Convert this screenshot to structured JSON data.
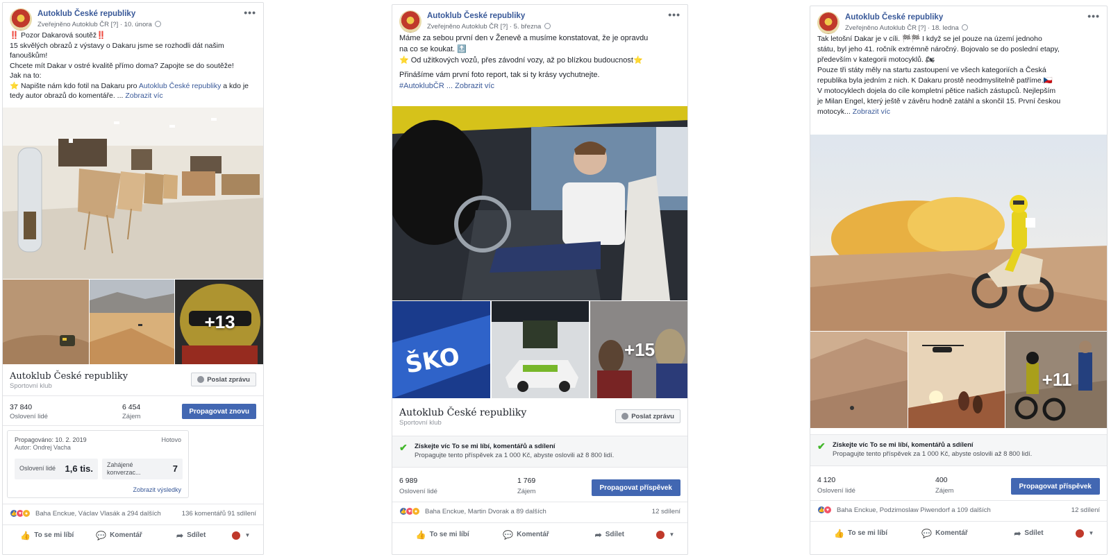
{
  "posts": [
    {
      "page_name": "Autoklub České republiky",
      "published_by": "Zveřejněno",
      "publisher": "Autoklub ČR",
      "q": "[?]",
      "date": "10. února",
      "menu": "•••",
      "text_lines": [
        "‼️ Pozor Dakarová soutěž‼️",
        "15 skvělých obrazů z výstavy o Dakaru jsme se rozhodli dát našim",
        "fanouškům!",
        "Chcete mít Dakar v ostré kvalitě přímo doma? Zapojte se do soutěže!",
        "Jak na to:"
      ],
      "line6_pre": "⭐  Napište nám kdo fotil na Dakaru pro ",
      "line6_link": "Autoklub České republiky",
      "line6_post": " a kdo je",
      "line7": "tedy autor obrazů do komentáře. ... ",
      "see_more": "Zobrazit víc",
      "plus": "+13",
      "pagebox_name": "Autoklub České republiky",
      "pagebox_category": "Sportovní klub",
      "message_btn": "Poslat zprávu",
      "reach_value": "37 840",
      "reach_label": "Oslovení lidé",
      "engage_value": "6 454",
      "engage_label": "Zájem",
      "boost_btn": "Propagovat znovu",
      "report": {
        "promoted": "Propagováno: 10. 2. 2019",
        "author": "Autor: Ondrej Vacha",
        "status": "Hotovo",
        "reach_label": "Oslovení lidé",
        "reach_value": "1,6 tis.",
        "conv_label1": "Zahájené",
        "conv_label2": "konverzac...",
        "conv_value": "7",
        "results_link": "Zobrazit výsledky"
      },
      "reactions_text": "Baha Enckue, Václav Vlasák a 294 dalších",
      "comments_shares": "136 komentářů  91 sdílení",
      "like": "To se mi líbí",
      "comment": "Komentář",
      "share": "Sdílet"
    },
    {
      "page_name": "Autoklub České republiky",
      "published_by": "Zveřejněno",
      "publisher": "Autoklub ČR",
      "q": "[?]",
      "date": "5. března",
      "menu": "•••",
      "line1": "Máme za sebou první den v Ženevě a musíme konstatovat, že je opravdu",
      "line2": "na co se koukat. 🔝",
      "line3": "⭐ Od užitkových vozů, přes závodní vozy, až po blízkou budoucnost⭐",
      "line4": "Přinášíme vám první foto report, tak si ty krásy vychutnejte.",
      "hashtag": "#AutoklubČR",
      "see_more": "... Zobrazit víc",
      "plus": "+15",
      "pagebox_name": "Autoklub České republiky",
      "pagebox_category": "Sportovní klub",
      "message_btn": "Poslat zprávu",
      "promo_title": "Získejte víc To se mi líbí, komentářů a sdílení",
      "promo_desc": "Propagujte tento příspěvek za 1 000 Kč, abyste oslovili až 8 800 lidí.",
      "reach_value": "6 989",
      "reach_label": "Oslovení lidé",
      "engage_value": "1 769",
      "engage_label": "Zájem",
      "boost_btn": "Propagovat příspěvek",
      "reactions_text": "Baha Enckue, Martin Dvorak a 89 dalších",
      "comments_shares": "12 sdílení",
      "like": "To se mi líbí",
      "comment": "Komentář",
      "share": "Sdílet"
    },
    {
      "page_name": "Autoklub České republiky",
      "published_by": "Zveřejněno",
      "publisher": "Autoklub ČR",
      "q": "[?]",
      "date": "18. ledna",
      "menu": "•••",
      "text_lines": [
        "Tak letošní Dakar je v cíli. 🏁🏁 I když se jel pouze na území jednoho",
        "státu, byl jeho 41. ročník extrémně náročný. Bojovalo se do poslední etapy,",
        "především v kategorii motocyklů. 🏍",
        "Pouze tři státy měly na startu zastoupení ve všech kategoriích a Česká",
        "republika byla jedním z nich. K Dakaru prostě neodmyslitelně patříme.🇨🇿",
        "V motocyklech dojela do cíle kompletní pětice našich zástupců. Nejlepším",
        "je Milan Engel, který ještě v závěru hodně zatáhl a skončil 15. První českou"
      ],
      "last_line": "motocyk... ",
      "see_more": "Zobrazit víc",
      "plus": "+11",
      "promo_title": "Získejte víc To se mi líbí, komentářů a sdílení",
      "promo_desc": "Propagujte tento příspěvek za 1 000 Kč, abyste oslovili až 8 800 lidí.",
      "reach_value": "4 120",
      "reach_label": "Oslovení lidé",
      "engage_value": "400",
      "engage_label": "Zájem",
      "boost_btn": "Propagovat příspěvek",
      "reactions_text": "Baha Enckue, Podzimoslaw Piwendorf a 109 dalších",
      "comments_shares": "12 sdílení",
      "like": "To se mi líbí",
      "comment": "Komentář",
      "share": "Sdílet"
    }
  ],
  "colors": {
    "link": "#385898",
    "boost": "#4267b2",
    "check": "#42b72a"
  }
}
